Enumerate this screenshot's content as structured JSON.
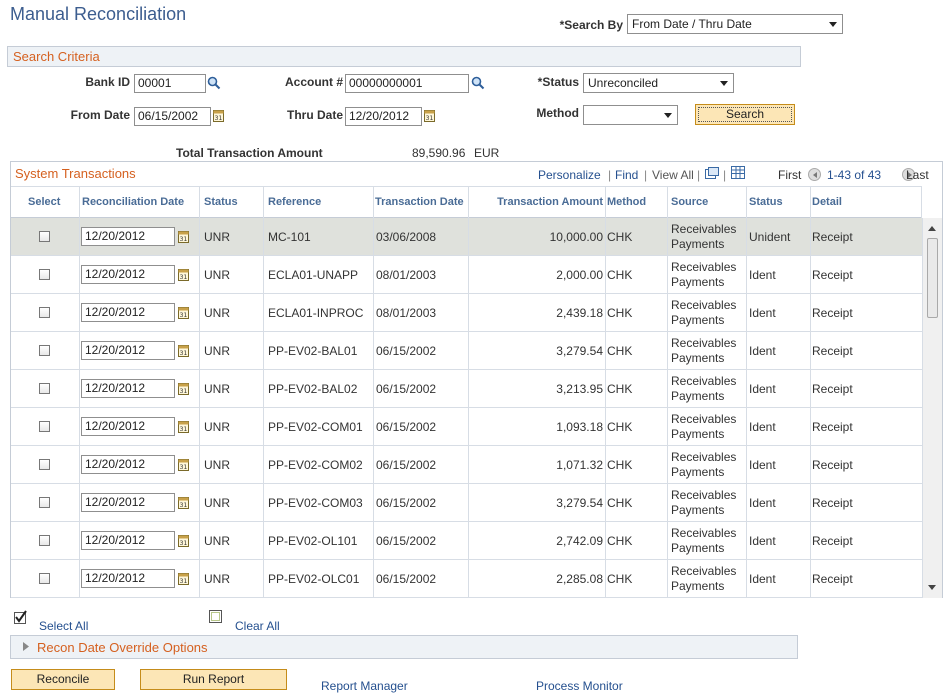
{
  "page_title": "Manual Reconciliation",
  "search_by": {
    "label": "*Search By",
    "value": "From Date / Thru Date"
  },
  "search_criteria": {
    "title": "Search Criteria",
    "bank_id": {
      "label": "Bank ID",
      "value": "00001"
    },
    "account": {
      "label": "Account #",
      "value": "00000000001"
    },
    "status": {
      "label": "*Status",
      "value": "Unreconciled"
    },
    "from_date": {
      "label": "From Date",
      "value": "06/15/2002"
    },
    "thru_date": {
      "label": "Thru Date",
      "value": "12/20/2012"
    },
    "method": {
      "label": "Method",
      "value": ""
    },
    "search_button": "Search"
  },
  "totals": {
    "label": "Total Transaction Amount",
    "value": "89,590.96",
    "currency": "EUR"
  },
  "grid": {
    "title": "System Transactions",
    "personalize": "Personalize",
    "find": "Find",
    "view_all": "View All",
    "first": "First",
    "range": "1-43 of 43",
    "last": "Last",
    "columns": [
      "Select",
      "Reconciliation Date",
      "Status",
      "Reference",
      "Transaction Date",
      "Transaction Amount",
      "Method",
      "Source",
      "Status",
      "Detail"
    ],
    "rows": [
      {
        "recon_date": "12/20/2012",
        "status": "UNR",
        "reference": "MC-101",
        "trans_date": "03/06/2008",
        "amount": "10,000.00",
        "method": "CHK",
        "source": "Receivables Payments",
        "status2": "Unident",
        "detail": "Receipt"
      },
      {
        "recon_date": "12/20/2012",
        "status": "UNR",
        "reference": "ECLA01-UNAPP",
        "trans_date": "08/01/2003",
        "amount": "2,000.00",
        "method": "CHK",
        "source": "Receivables Payments",
        "status2": "Ident",
        "detail": "Receipt"
      },
      {
        "recon_date": "12/20/2012",
        "status": "UNR",
        "reference": "ECLA01-INPROC",
        "trans_date": "08/01/2003",
        "amount": "2,439.18",
        "method": "CHK",
        "source": "Receivables Payments",
        "status2": "Ident",
        "detail": "Receipt"
      },
      {
        "recon_date": "12/20/2012",
        "status": "UNR",
        "reference": "PP-EV02-BAL01",
        "trans_date": "06/15/2002",
        "amount": "3,279.54",
        "method": "CHK",
        "source": "Receivables Payments",
        "status2": "Ident",
        "detail": "Receipt"
      },
      {
        "recon_date": "12/20/2012",
        "status": "UNR",
        "reference": "PP-EV02-BAL02",
        "trans_date": "06/15/2002",
        "amount": "3,213.95",
        "method": "CHK",
        "source": "Receivables Payments",
        "status2": "Ident",
        "detail": "Receipt"
      },
      {
        "recon_date": "12/20/2012",
        "status": "UNR",
        "reference": "PP-EV02-COM01",
        "trans_date": "06/15/2002",
        "amount": "1,093.18",
        "method": "CHK",
        "source": "Receivables Payments",
        "status2": "Ident",
        "detail": "Receipt"
      },
      {
        "recon_date": "12/20/2012",
        "status": "UNR",
        "reference": "PP-EV02-COM02",
        "trans_date": "06/15/2002",
        "amount": "1,071.32",
        "method": "CHK",
        "source": "Receivables Payments",
        "status2": "Ident",
        "detail": "Receipt"
      },
      {
        "recon_date": "12/20/2012",
        "status": "UNR",
        "reference": "PP-EV02-COM03",
        "trans_date": "06/15/2002",
        "amount": "3,279.54",
        "method": "CHK",
        "source": "Receivables Payments",
        "status2": "Ident",
        "detail": "Receipt"
      },
      {
        "recon_date": "12/20/2012",
        "status": "UNR",
        "reference": "PP-EV02-OL101",
        "trans_date": "06/15/2002",
        "amount": "2,742.09",
        "method": "CHK",
        "source": "Receivables Payments",
        "status2": "Ident",
        "detail": "Receipt"
      },
      {
        "recon_date": "12/20/2012",
        "status": "UNR",
        "reference": "PP-EV02-OLC01",
        "trans_date": "06/15/2002",
        "amount": "2,285.08",
        "method": "CHK",
        "source": "Receivables Payments",
        "status2": "Ident",
        "detail": "Receipt"
      }
    ]
  },
  "select_all": "Select All",
  "clear_all": "Clear All",
  "recon_override": "Recon Date Override Options",
  "buttons": {
    "reconcile": "Reconcile",
    "run_report": "Run Report"
  },
  "links": {
    "report_manager": "Report Manager",
    "process_monitor": "Process Monitor"
  },
  "colors": {
    "accent_orange": "#d5601f",
    "link_blue": "#25508f",
    "button_fill": "#fce6b6"
  }
}
